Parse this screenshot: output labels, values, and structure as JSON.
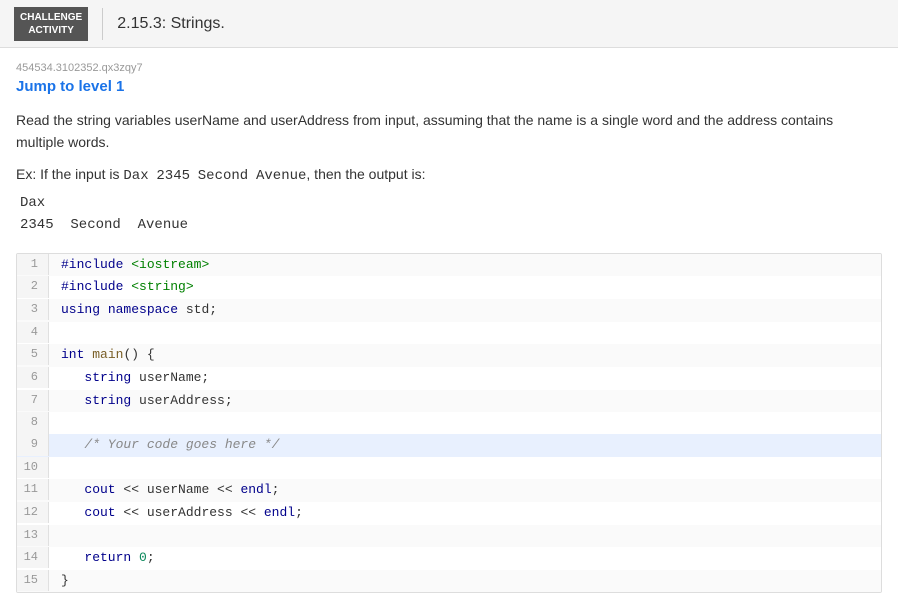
{
  "header": {
    "badge_line1": "CHALLENGE",
    "badge_line2": "ACTIVITY",
    "divider": true,
    "title": "2.15.3: Strings."
  },
  "activity": {
    "id": "454534.3102352.qx3zqy7",
    "jump_link": "Jump to level 1",
    "description1": "Read the string variables userName and userAddress from input, assuming that the name is a single word and the address contains multiple words.",
    "example_label": "Ex: If the input is Dax  2345  Second  Avenue, then the output is:",
    "example_output_line1": "Dax",
    "example_output_line2": "  2345  Second  Avenue",
    "code": {
      "lines": [
        {
          "num": "1",
          "content": "#include <iostream>",
          "type": "include"
        },
        {
          "num": "2",
          "content": "#include <string>",
          "type": "include"
        },
        {
          "num": "3",
          "content": "using namespace std;",
          "type": "using"
        },
        {
          "num": "4",
          "content": "",
          "type": "blank"
        },
        {
          "num": "5",
          "content": "int main() {",
          "type": "main"
        },
        {
          "num": "6",
          "content": "   string userName;",
          "type": "var"
        },
        {
          "num": "7",
          "content": "   string userAddress;",
          "type": "var"
        },
        {
          "num": "8",
          "content": "",
          "type": "blank"
        },
        {
          "num": "9",
          "content": "   /* Your code goes here */",
          "type": "comment",
          "highlight": true
        },
        {
          "num": "10",
          "content": "",
          "type": "blank"
        },
        {
          "num": "11",
          "content": "   cout << userName << endl;",
          "type": "stmt"
        },
        {
          "num": "12",
          "content": "   cout << userAddress << endl;",
          "type": "stmt"
        },
        {
          "num": "13",
          "content": "",
          "type": "blank"
        },
        {
          "num": "14",
          "content": "   return 0;",
          "type": "return"
        },
        {
          "num": "15",
          "content": "}",
          "type": "brace"
        }
      ]
    }
  }
}
